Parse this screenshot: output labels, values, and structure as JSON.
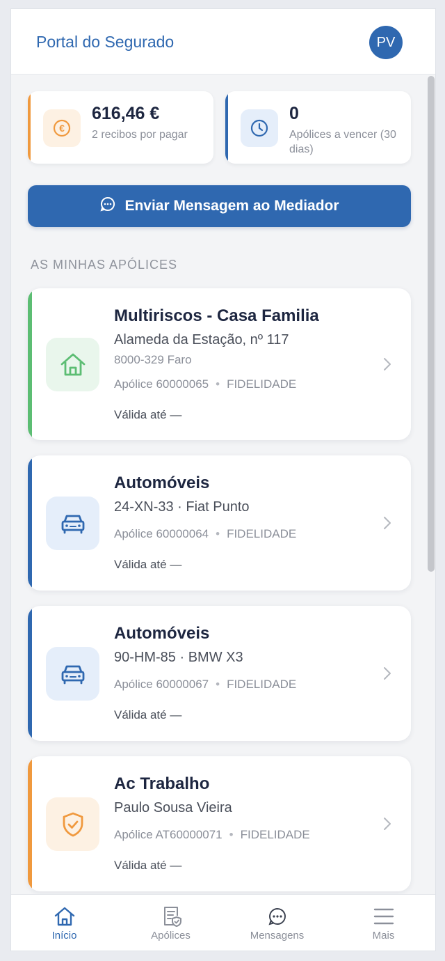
{
  "header": {
    "title": "Portal do Segurado",
    "avatar_initials": "PV"
  },
  "stats": [
    {
      "value": "616,46 €",
      "label": "2 recibos por pagar",
      "icon": "euro-icon",
      "accent": "#f0993e"
    },
    {
      "value": "0",
      "label": "Apólices a vencer (30 dias)",
      "icon": "clock-icon",
      "accent": "#2f68b0"
    }
  ],
  "message_button": {
    "label": "Enviar Mensagem ao Mediador",
    "icon": "chat-icon"
  },
  "policies_section": {
    "title": "AS MINHAS APÓLICES"
  },
  "policies": [
    {
      "title": "Multiriscos - Casa Familia",
      "line1": "Alameda da Estação, nº 117",
      "line2": "8000-329 Faro",
      "policy_number": "Apólice 60000065",
      "insurer": "FIDELIDADE",
      "valid_until": "Válida até —",
      "icon": "house-icon",
      "accent": "#5cbd73"
    },
    {
      "title": "Automóveis",
      "line1": "24-XN-33 · Fiat Punto",
      "policy_number": "Apólice 60000064",
      "insurer": "FIDELIDADE",
      "valid_until": "Válida até —",
      "icon": "car-icon",
      "accent": "#2f68b0"
    },
    {
      "title": "Automóveis",
      "line1": "90-HM-85 · BMW X3",
      "policy_number": "Apólice 60000067",
      "insurer": "FIDELIDADE",
      "valid_until": "Válida até —",
      "icon": "car-icon",
      "accent": "#2f68b0"
    },
    {
      "title": "Ac Trabalho",
      "line1": "Paulo Sousa Vieira",
      "policy_number": "Apólice AT60000071",
      "insurer": "FIDELIDADE",
      "valid_until": "Válida até —",
      "icon": "shield-check-icon",
      "accent": "#f0993e"
    }
  ],
  "tabbar": {
    "items": [
      {
        "label": "Início",
        "icon": "home-icon",
        "active": true
      },
      {
        "label": "Apólices",
        "icon": "policy-document-icon",
        "active": false
      },
      {
        "label": "Mensagens",
        "icon": "chat-icon",
        "active": false
      },
      {
        "label": "Mais",
        "icon": "menu-icon",
        "active": false
      }
    ]
  },
  "colors": {
    "primary": "#2f68b0",
    "orange": "#f0993e",
    "green": "#5cbd73",
    "background": "#f3f4f6"
  }
}
